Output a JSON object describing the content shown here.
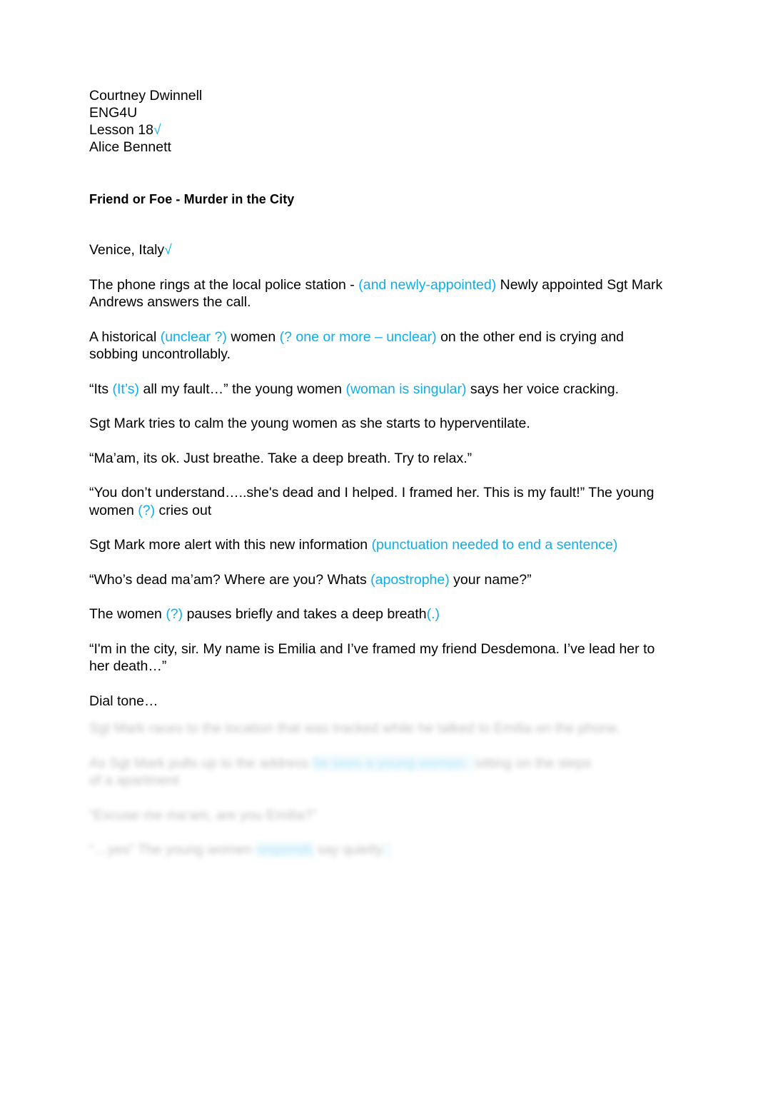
{
  "document": {
    "header_lines": [
      "Courtney Dwinnell",
      "ENG4U",
      "Lesson 18",
      "Alice Bennett"
    ],
    "lesson_check_mark": "√",
    "title": "Friend or Foe - Murder in the City",
    "location": "Venice, Italy",
    "location_check_mark": "√",
    "annotation_color": "#0eaee8",
    "paragraphs": {
      "p1_a": "The phone rings at the local police station - ",
      "p1_ann": "(and newly-appointed)",
      "p1_b": " Newly appointed Sgt Mark Andrews answers the call.",
      "p2_a": "A historical ",
      "p2_ann1": "(unclear ?)",
      "p2_b": " women ",
      "p2_ann2": "(? one or more – unclear)",
      "p2_c": " on the other end is crying and sobbing uncontrollably.",
      "p3_a": "“Its ",
      "p3_ann1": "(It’s)",
      "p3_b": " all my fault…” the young women ",
      "p3_ann2": "(woman is singular)",
      "p3_c": " says her voice cracking.",
      "p4": "Sgt Mark tries to calm the young women as she starts to hyperventilate.",
      "p5": "“Ma’am, its ok. Just breathe. Take a deep breath. Try to relax.”",
      "p6_a": "“You don’t understand…..she's dead and I helped. I framed her. This is my fault!” The young women ",
      "p6_ann": "(?)",
      "p6_b": " cries out",
      "p7_a": "Sgt Mark more alert with this new information ",
      "p7_ann": "(punctuation needed to end a sentence)",
      "p8_a": "“Who’s dead ma’am? Where are you? Whats ",
      "p8_ann": "(apostrophe)",
      "p8_b": " your name?”",
      "p9_a": "The women ",
      "p9_ann1": "(?)",
      "p9_b": " pauses briefly and takes a deep breath",
      "p9_ann2": "(.)",
      "p10": "“I'm in the city, sir. My name is Emilia and I’ve framed my friend Desdemona. I’ve lead her to her death…”",
      "p11": "Dial tone…"
    },
    "obscured_section": {
      "note": "illegible blurred text",
      "line1": "Sgt Mark races to the location that was tracked while he talked to Emilia on the phone.",
      "line2_a": "As Sgt Mark pulls up to the address ",
      "line2_hl": "he sees a young woman ",
      "line2_b": "sitting on the steps",
      "line2_c": "of a apartment",
      "line3": "“Excuse me ma’am, are you Emilia?”",
      "line4_a": "“…yes” The young women ",
      "line4_hl": "responds",
      "line4_b": " say quietly"
    }
  }
}
